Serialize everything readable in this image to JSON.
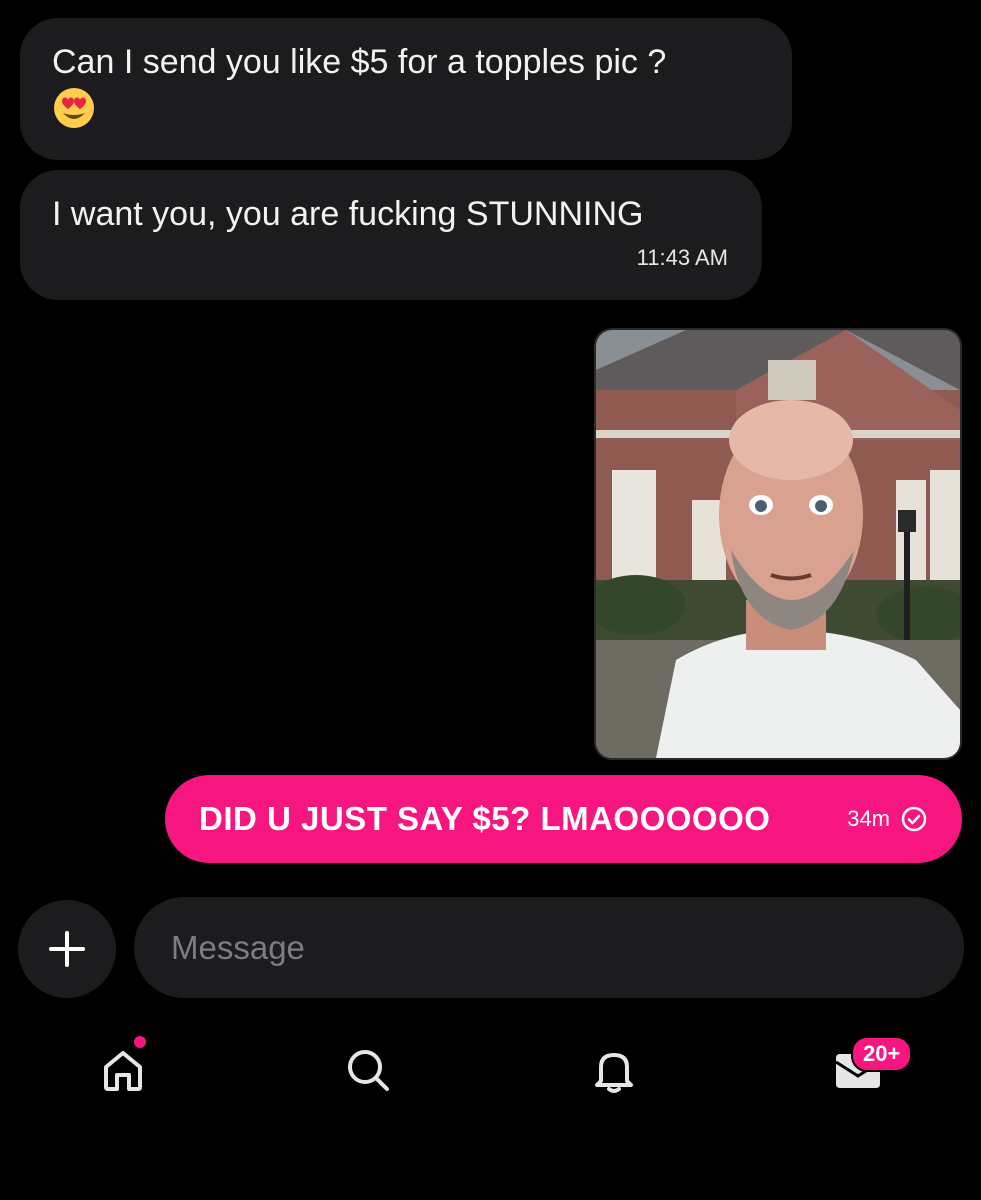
{
  "messages_incoming": [
    {
      "text": "Can I send you like $5 for a topples pic ?",
      "emoji": "heart-eyes-emoji"
    },
    {
      "text": "I want you, you are fucking STUNNING",
      "time": "11:43 AM"
    }
  ],
  "outgoing": {
    "text": "DID U JUST SAY $5? LMAOOOOOO",
    "time": "34m",
    "status_icon": "check-circle-icon"
  },
  "composer": {
    "add_icon": "plus-icon",
    "placeholder": "Message"
  },
  "bottom_nav": {
    "items": [
      {
        "name": "home",
        "icon": "home-icon",
        "has_dot": true
      },
      {
        "name": "search",
        "icon": "search-icon"
      },
      {
        "name": "notifications",
        "icon": "bell-icon"
      },
      {
        "name": "inbox",
        "icon": "inbox-icon",
        "badge": "20+"
      }
    ]
  },
  "colors": {
    "accent": "#f7157f",
    "bubble_incoming": "#1c1c1e",
    "background": "#000000"
  }
}
